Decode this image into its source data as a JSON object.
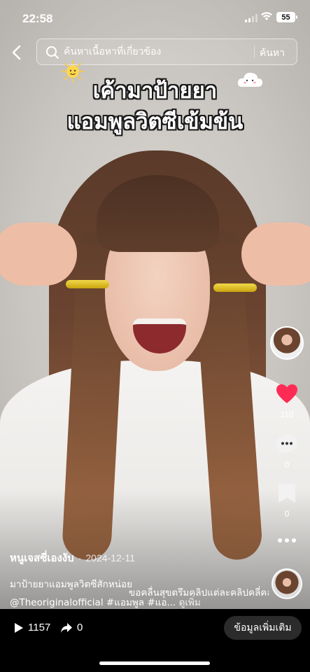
{
  "status_bar": {
    "time": "22:58",
    "battery": "55"
  },
  "search": {
    "placeholder": "ค้นหาเนื้อหาที่เกี่ยวข้อง",
    "button_label": "ค้นหา"
  },
  "video": {
    "overlay_title_line1": "เค้ามาป้ายยา",
    "overlay_title_line2": "แอมพูลวิตซีเข้มข้น"
  },
  "rail": {
    "like_count": "110",
    "comment_count": "0",
    "save_count": "0",
    "like_color": "#fe2c55"
  },
  "caption": {
    "author": "หนูเจสซี่เองงับ",
    "date": "2024-12-11",
    "description": "มาป้ายยาแอมพูลวิตซีสักหน่อย",
    "tags": "@Theoriginalofficial  #แอมพูล #แอ...",
    "more_label": "ดูเพิ่ม",
    "sound_text": "ขอคลื่นสุขตรึมคลิปแต่ละคลิปคลี่คลาย"
  },
  "bottom_bar": {
    "views": "1157",
    "shares": "0",
    "more_info_label": "ข้อมูลเพิ่มเติม"
  },
  "icons": {
    "back": "chevron-left-icon",
    "search": "search-icon",
    "like": "heart-icon",
    "comment": "comment-icon",
    "save": "bookmark-icon",
    "more": "ellipsis-icon",
    "views": "play-icon",
    "shares": "share-arrow-icon"
  }
}
